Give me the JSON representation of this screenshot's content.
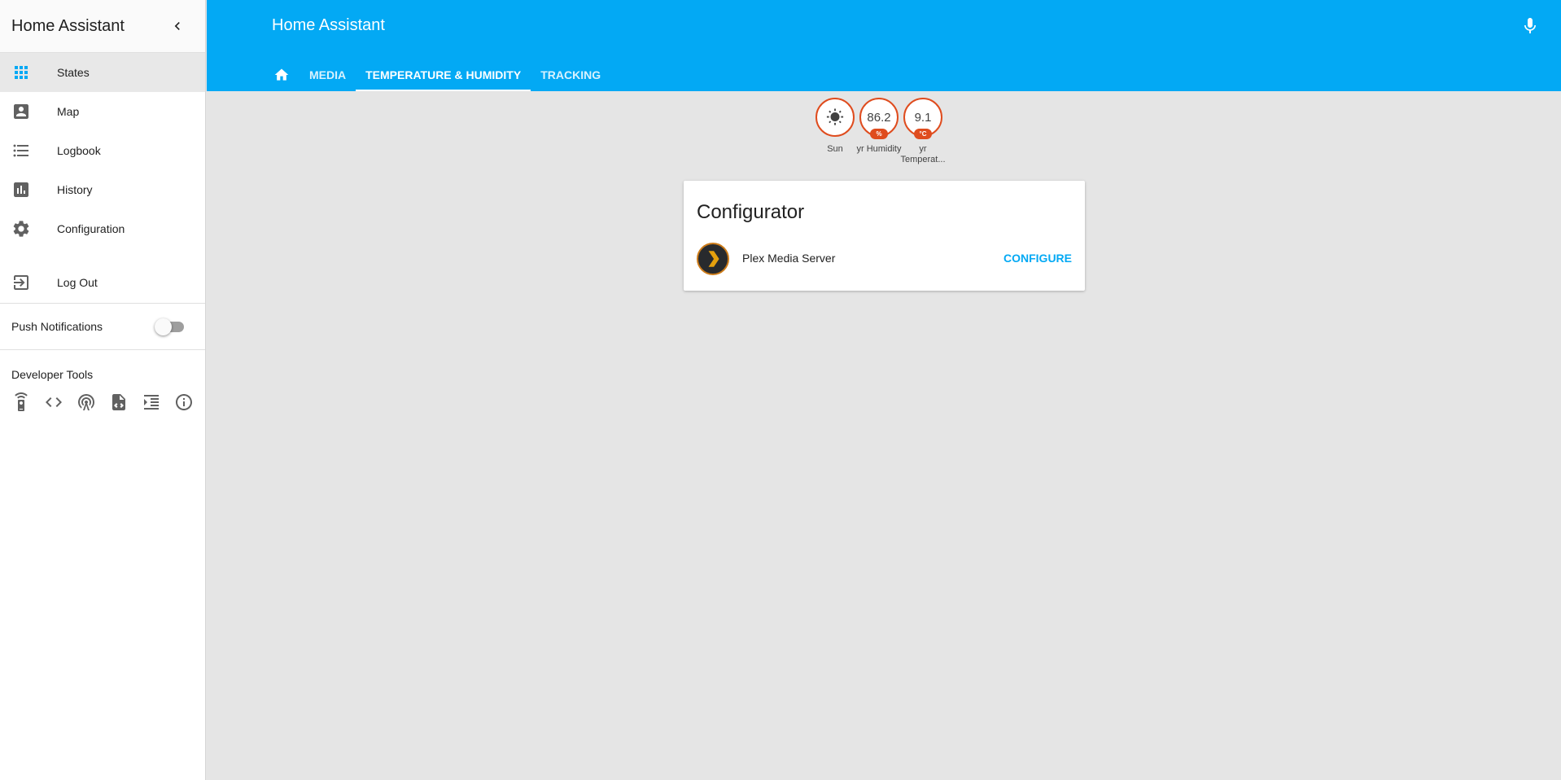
{
  "sidebar": {
    "title": "Home Assistant",
    "items": [
      {
        "label": "States",
        "icon": "apps-icon"
      },
      {
        "label": "Map",
        "icon": "account-box-icon"
      },
      {
        "label": "Logbook",
        "icon": "format-list-bulleted-icon"
      },
      {
        "label": "History",
        "icon": "chart-bar-icon"
      },
      {
        "label": "Configuration",
        "icon": "settings-icon"
      }
    ],
    "logout_label": "Log Out",
    "push_notifications_label": "Push Notifications",
    "push_notifications_enabled": false,
    "developer_tools_title": "Developer Tools",
    "accent_color": "#03a9f4"
  },
  "header": {
    "title": "Home Assistant",
    "tabs": [
      {
        "label": "MEDIA"
      },
      {
        "label": "TEMPERATURE & HUMIDITY"
      },
      {
        "label": "TRACKING"
      }
    ],
    "active_tab": "TEMPERATURE & HUMIDITY",
    "color": "#03a9f4"
  },
  "badges": [
    {
      "value": "",
      "unit": "",
      "label": "Sun",
      "icon": "sun-icon"
    },
    {
      "value": "86.2",
      "unit": "%",
      "label": "yr Humidity"
    },
    {
      "value": "9.1",
      "unit": "°C",
      "label": "yr Temperat..."
    }
  ],
  "configurator": {
    "title": "Configurator",
    "entity_name": "Plex Media Server",
    "action_label": "CONFIGURE"
  }
}
